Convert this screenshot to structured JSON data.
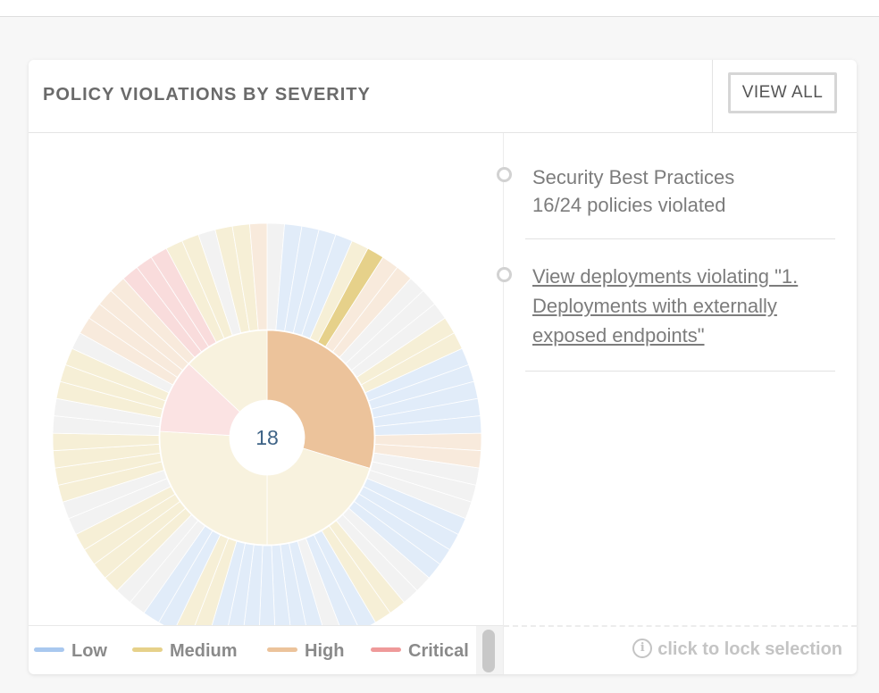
{
  "card": {
    "title": "POLICY VIOLATIONS BY SEVERITY",
    "view_all_label": "VIEW ALL"
  },
  "details": {
    "entries": [
      {
        "title": "Security Best Practices",
        "subtitle": "16/24 policies violated"
      },
      {
        "link": "View deployments violating \"1. Deployments with externally exposed endpoints\""
      }
    ],
    "lock_hint": "click to lock selection",
    "info_icon": "info-icon"
  },
  "colors": {
    "low": "#a9c8ef",
    "medium": "#e6d18a",
    "high": "#ecc39b",
    "critical": "#ef9a9a",
    "none": "#e3e3e3"
  },
  "chart_data": {
    "type": "sunburst",
    "center_label": "18",
    "legend": [
      {
        "name": "Low",
        "key": "low"
      },
      {
        "name": "Medium",
        "key": "medium"
      },
      {
        "name": "High",
        "key": "high"
      },
      {
        "name": "Critical",
        "key": "critical"
      }
    ],
    "inner_ring": [
      {
        "key": "high",
        "value": 16,
        "highlight": true
      },
      {
        "key": "medium",
        "value": 11,
        "highlight": false
      },
      {
        "key": "medium",
        "value": 14,
        "highlight": false
      },
      {
        "key": "critical",
        "value": 6,
        "highlight": false
      },
      {
        "key": "medium",
        "value": 7,
        "highlight": false
      }
    ],
    "outer_ring": [
      {
        "key": "none",
        "count": 1,
        "highlight": false
      },
      {
        "key": "low",
        "count": 4,
        "highlight": false
      },
      {
        "key": "medium",
        "count": 1,
        "highlight": false
      },
      {
        "key": "medium",
        "count": 1,
        "highlight": true
      },
      {
        "key": "high",
        "count": 2,
        "highlight": false
      },
      {
        "key": "none",
        "count": 3,
        "highlight": false
      },
      {
        "key": "medium",
        "count": 2,
        "highlight": false
      },
      {
        "key": "low",
        "count": 5,
        "highlight": false
      },
      {
        "key": "high",
        "count": 2,
        "highlight": false
      },
      {
        "key": "none",
        "count": 3,
        "highlight": false
      },
      {
        "key": "low",
        "count": 4,
        "highlight": false
      },
      {
        "key": "none",
        "count": 2,
        "highlight": false
      },
      {
        "key": "medium",
        "count": 2,
        "highlight": false
      },
      {
        "key": "low",
        "count": 2,
        "highlight": false
      },
      {
        "key": "none",
        "count": 1,
        "highlight": false
      },
      {
        "key": "low",
        "count": 7,
        "highlight": false
      },
      {
        "key": "medium",
        "count": 2,
        "highlight": false
      },
      {
        "key": "low",
        "count": 2,
        "highlight": false
      },
      {
        "key": "none",
        "count": 2,
        "highlight": false
      },
      {
        "key": "medium",
        "count": 4,
        "highlight": false
      },
      {
        "key": "none",
        "count": 2,
        "highlight": false
      },
      {
        "key": "medium",
        "count": 4,
        "highlight": false
      },
      {
        "key": "none",
        "count": 2,
        "highlight": false
      },
      {
        "key": "medium",
        "count": 3,
        "highlight": false
      },
      {
        "key": "none",
        "count": 1,
        "highlight": false
      },
      {
        "key": "high",
        "count": 4,
        "highlight": false
      },
      {
        "key": "critical",
        "count": 3,
        "highlight": false
      },
      {
        "key": "medium",
        "count": 2,
        "highlight": false
      },
      {
        "key": "none",
        "count": 1,
        "highlight": false
      },
      {
        "key": "medium",
        "count": 2,
        "highlight": false
      },
      {
        "key": "high",
        "count": 1,
        "highlight": false
      }
    ]
  }
}
